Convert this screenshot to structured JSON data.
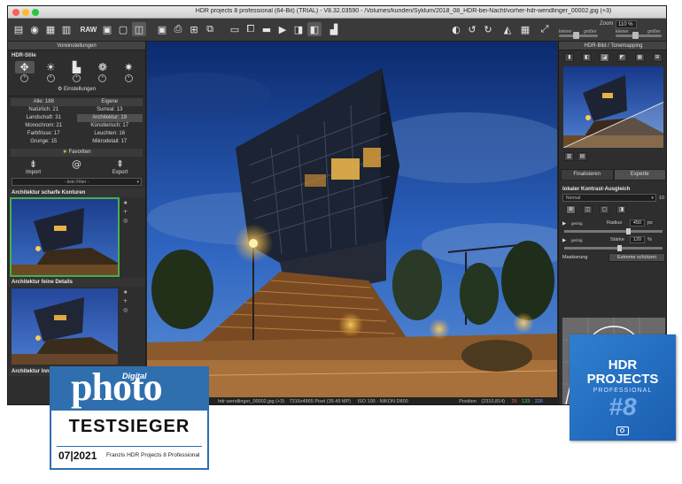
{
  "window": {
    "title": "HDR projects 8 professional (64-Bit) (TRIAL) - V8.32.03590 - /Volumes/kunden/Syklum/2018_08_HDR-bei-Nacht/vorher-hdr-wendlinger_00002.jpg (+3)",
    "colors": {
      "close": "#fe5f57",
      "minimize": "#febc2e",
      "maximize": "#28c840"
    }
  },
  "toolbar": {
    "raw_label": "RAW",
    "zoom_label": "Zoom",
    "zoom_value": "110",
    "zoom_unit": "%",
    "slider_left_min": "kleiner",
    "slider_left_max": "größer",
    "slider_right_min": "kleiner",
    "slider_right_max": "größer"
  },
  "left_panel": {
    "header": "Voreinstellungen",
    "styles_title": "HDR-Stile",
    "style_icons": [
      "people-group-icon",
      "sun-icon",
      "buildings-icon",
      "palette-icon",
      "sparkle-icon"
    ],
    "settings_label": "Einstellungen",
    "filters": [
      {
        "left": "Alle: 188",
        "right": "Eigene"
      },
      {
        "left": "Natürlich: 21",
        "right": "Surreal: 13"
      },
      {
        "left": "Landschaft: 31",
        "right": "Architektur: 19"
      },
      {
        "left": "Monochrom: 21",
        "right": "Künstlerisch: 17"
      },
      {
        "left": "Farbfrisse: 17",
        "right": "Leuchten: 16"
      },
      {
        "left": "Grunge: 15",
        "right": "Mikrodetail: 17"
      }
    ],
    "favorites_label": "Favoriten",
    "import_label": "Import",
    "export_label": "Export",
    "filter_select": "- kein Filter -",
    "presets": [
      {
        "title": "Architektur scharfe Konturen"
      },
      {
        "title": "Architektur feine Details"
      },
      {
        "title": "Architektur Inn"
      }
    ]
  },
  "statusbar": {
    "filename": "hdr-wendlinger_00002.jpg (+3)",
    "size": "7316x4865 Pixel (35.49 MP)",
    "exif": "ISO 100 - NIKON D800",
    "position": "Position",
    "coords": "(2310,814)",
    "r": "25",
    "g": "133",
    "b": "226"
  },
  "right_panel": {
    "header": "HDR-Bild / Tonemapping",
    "tab_finalize": "Finalisieren",
    "tab_expert": "Experte",
    "section_title": "lokaler Kontrast-Ausgleich",
    "mode_select": "Normal",
    "mode_value": "10",
    "radius_label": "Radius",
    "radius_value": "450",
    "radius_unit": "px",
    "strength_label": "Stärke",
    "strength_value": "120",
    "strength_unit": "%",
    "low_label": "gering",
    "mask_label": "Maskierung",
    "mask_button": "Extreme schützen"
  },
  "badges": {
    "magazine_small": "Digital",
    "magazine": "photo",
    "award": "TESTSIEGER",
    "issue": "07|2021",
    "product": "Franzis HDR Projects 8 Professional",
    "hdr_line1": "HDR",
    "hdr_line2": "PROJECTS",
    "hdr_line3": "PROFESSIONAL",
    "hdr_number": "#8"
  }
}
